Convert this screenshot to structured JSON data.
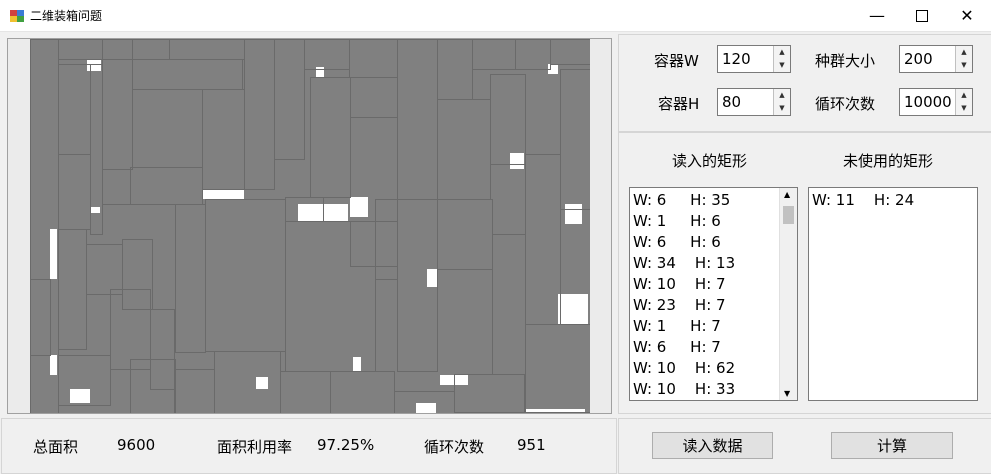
{
  "window": {
    "title": "二维装箱问题"
  },
  "params": {
    "container_w_label": "容器W",
    "container_w_value": "120",
    "container_h_label": "容器H",
    "container_h_value": "80",
    "population_label": "种群大小",
    "population_value": "200",
    "iterations_label": "循环次数",
    "iterations_value": "10000"
  },
  "lists": {
    "loaded_title": "读入的矩形",
    "unused_title": "未使用的矩形",
    "loaded_items": [
      "W: 6     H: 35",
      "W: 1     H: 6",
      "W: 6     H: 6",
      "W: 34    H: 13",
      "W: 10    H: 7",
      "W: 23    H: 7",
      "W: 1     H: 7",
      "W: 6     H: 7",
      "W: 10    H: 62",
      "W: 10    H: 33"
    ],
    "unused_items": [
      "W: 11    H: 24"
    ]
  },
  "stats": {
    "total_area_label": "总面积",
    "total_area_value": "9600",
    "utilization_label": "面积利用率",
    "utilization_value": "97.25%",
    "iterations_label": "循环次数",
    "iterations_value": "951"
  },
  "buttons": {
    "read_data": "读入数据",
    "compute": "计算"
  },
  "colors": {
    "rect_fill": "#808080",
    "rect_border": "#6a6a6a",
    "empty": "#ffffff",
    "bg": "#f0f0f0"
  }
}
